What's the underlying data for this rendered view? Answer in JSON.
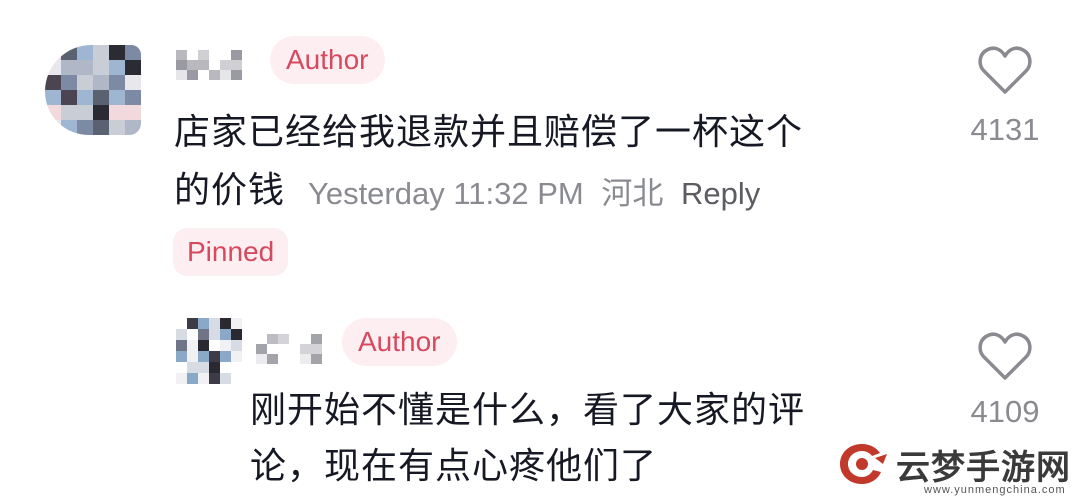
{
  "comments": [
    {
      "author_tag": "Author",
      "text_line1": "店家已经给我退款并且赔偿了一杯这个",
      "text_line2": "的价钱",
      "time": "Yesterday 11:32 PM",
      "location": "河北",
      "reply_label": "Reply",
      "likes": "4131",
      "pinned_label": "Pinned"
    },
    {
      "author_tag": "Author",
      "text_line1": "刚开始不懂是什么，看了大家的评",
      "text_line2": "论，现在有点心疼他们了",
      "likes": "4109"
    }
  ],
  "icons": {
    "like": "heart-outline-icon",
    "watermark": "yunmeng-logo-icon"
  },
  "watermark": {
    "name": "云梦手游网",
    "url": "www.yunmengchina.com"
  },
  "colors": {
    "tag_bg": "#fdeff1",
    "tag_text": "#d6495f",
    "meta_text": "#8a8b91",
    "watermark_red": "#c0392b"
  }
}
